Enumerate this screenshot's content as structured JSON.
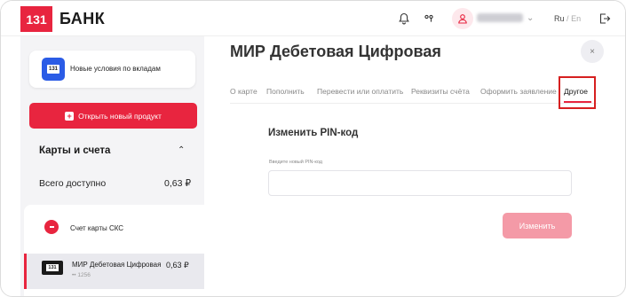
{
  "header": {
    "logo_badge": "131",
    "logo_text": "БАНК",
    "lang_ru": "Ru",
    "lang_sep": "/",
    "lang_en": "En",
    "icons": [
      "bell-icon",
      "key-icon",
      "user-icon",
      "chevron-down-icon",
      "logout-icon"
    ]
  },
  "sidebar": {
    "promo_badge": "131",
    "promo_text": "Новые условия по вкладам",
    "new_product_label": "Открыть новый продукт",
    "accounts_title": "Карты и счета",
    "total_label": "Всего доступно",
    "total_value": "0,63 ₽",
    "sks_account": "Счет карты СКС",
    "card": {
      "badge": "131",
      "name": "МИР Дебетовая Цифровая",
      "number": "•• 1256",
      "amount": "0,63 ₽"
    }
  },
  "main": {
    "title": "МИР Дебетовая Цифровая",
    "close_symbol": "×",
    "tabs": [
      {
        "label": "О карте"
      },
      {
        "label": "Пополнить"
      },
      {
        "label": "Перевести или оплатить"
      },
      {
        "label": "Реквизиты счёта"
      },
      {
        "label": "Оформить заявление"
      },
      {
        "label": "Другое"
      }
    ],
    "active_tab": "Другое",
    "section_title": "Изменить PIN-код",
    "pin_field_label": "Введите новый PIN-код",
    "pin_field_value": "",
    "submit_label": "Изменить"
  },
  "colors": {
    "brand_red": "#e8253f",
    "disabled_button": "#f49aa7",
    "highlight_box": "#d62020",
    "promo_blue": "#2b5ce6"
  }
}
